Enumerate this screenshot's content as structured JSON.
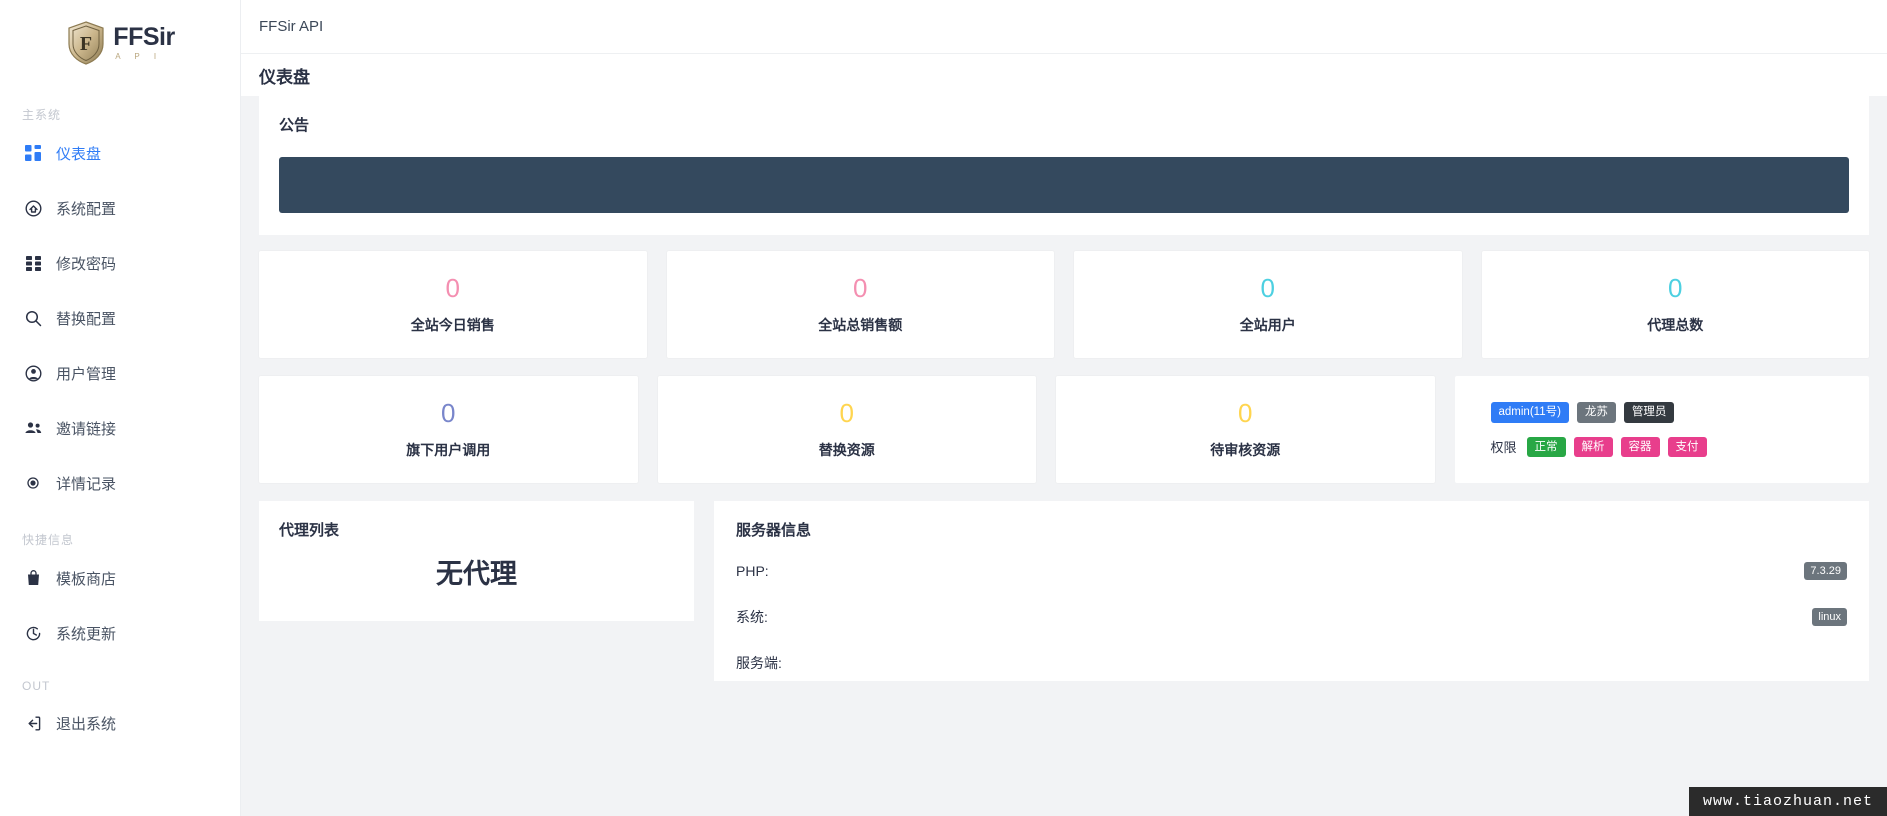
{
  "brand": {
    "name": "FFSir",
    "sub": "A P I",
    "logo_icon": "shield-logo-icon"
  },
  "sidebar": {
    "sections": [
      {
        "title": "主系统",
        "items": [
          {
            "label": "仪表盘",
            "icon": "dashboard-grid-icon",
            "active": true
          },
          {
            "label": "系统配置",
            "icon": "gear-home-icon",
            "active": false
          },
          {
            "label": "修改密码",
            "icon": "grid-blocks-icon",
            "active": false
          },
          {
            "label": "替换配置",
            "icon": "search-icon",
            "active": false
          },
          {
            "label": "用户管理",
            "icon": "user-circle-icon",
            "active": false
          },
          {
            "label": "邀请链接",
            "icon": "users-group-icon",
            "active": false
          },
          {
            "label": "详情记录",
            "icon": "dot-record-icon",
            "active": false
          }
        ]
      },
      {
        "title": "快捷信息",
        "items": [
          {
            "label": "模板商店",
            "icon": "shop-bag-icon",
            "active": false
          },
          {
            "label": "系统更新",
            "icon": "refresh-icon",
            "active": false
          }
        ]
      },
      {
        "title": "OUT",
        "items": [
          {
            "label": "退出系统",
            "icon": "logout-icon",
            "active": false
          }
        ]
      }
    ]
  },
  "topbar": {
    "title": "FFSir API"
  },
  "page": {
    "title": "仪表盘"
  },
  "notice": {
    "title": "公告",
    "body": ""
  },
  "stats": {
    "row1": [
      {
        "value": "0",
        "label": "全站今日销售",
        "color": "#f48fb1"
      },
      {
        "value": "0",
        "label": "全站总销售额",
        "color": "#f48fb1"
      },
      {
        "value": "0",
        "label": "全站用户",
        "color": "#4dd0e1"
      },
      {
        "value": "0",
        "label": "代理总数",
        "color": "#4dd0e1"
      }
    ],
    "row2": [
      {
        "value": "0",
        "label": "旗下用户调用",
        "color": "#7986cb"
      },
      {
        "value": "0",
        "label": "替换资源",
        "color": "#ffd54f"
      },
      {
        "value": "0",
        "label": "待审核资源",
        "color": "#ffd54f"
      }
    ]
  },
  "account": {
    "name_badge": "admin(11号)",
    "name_badge_color": "#2f7cf6",
    "nick_badge": "龙苏",
    "nick_badge_color": "#6c757d",
    "role_badge": "管理员",
    "role_badge_color": "#343a40",
    "perm_label": "权限",
    "permissions": [
      {
        "label": "正常",
        "color": "#28a745"
      },
      {
        "label": "解析",
        "color": "#e83e8c"
      },
      {
        "label": "容器",
        "color": "#e83e8c"
      },
      {
        "label": "支付",
        "color": "#e83e8c"
      }
    ]
  },
  "agent_list": {
    "title": "代理列表",
    "empty_text": "无代理"
  },
  "server_info": {
    "title": "服务器信息",
    "rows": [
      {
        "label": "PHP:",
        "value": "7.3.29"
      },
      {
        "label": "系统:",
        "value": "linux"
      },
      {
        "label": "服务端:",
        "value": ""
      }
    ]
  },
  "watermark": {
    "text": "www.tiaozhuan.net"
  }
}
